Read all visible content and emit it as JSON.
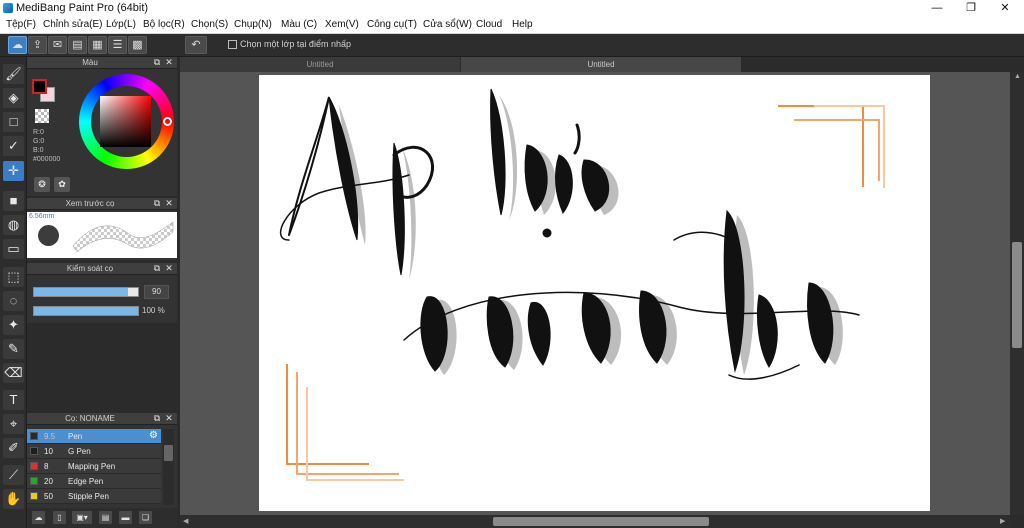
{
  "window": {
    "title": "MediBang Paint Pro (64bit)",
    "minimize": "—",
    "maximize": "❐",
    "close": "✕"
  },
  "menu": [
    "Tệp(F)",
    "Chỉnh sửa(E)",
    "Lớp(L)",
    "Bộ lọc(R)",
    "Chọn(S)",
    "Chụp(N)",
    "Màu (C)",
    "Xem(V)",
    "Công cụ(T)",
    "Cửa sổ(W)",
    "Cloud",
    "Help"
  ],
  "toolbar": {
    "checkbox_label": "Chọn một lớp tại điểm nhấp",
    "checkbox_checked": false
  },
  "color_panel": {
    "title": "Màu",
    "r": "R:0",
    "g": "G:0",
    "b": "B:0",
    "hex": "#000000",
    "foreground": "#000000",
    "background": "#f1d6dc"
  },
  "preview_panel": {
    "title": "Xem trước cọ",
    "size": "6.56mm"
  },
  "control_panel": {
    "title": "Kiểm soát cọ",
    "size_value": "90",
    "size_level": 0.9,
    "opacity_value": "100 %",
    "opacity_level": 1.0
  },
  "brush_panel": {
    "title": "Cọ: NONAME",
    "items": [
      {
        "size": "9.5",
        "name": "Pen",
        "color": "#2a2a2a",
        "selected": true
      },
      {
        "size": "10",
        "name": "G Pen",
        "color": "#1e1e1e",
        "selected": false
      },
      {
        "size": "8",
        "name": "Mapping Pen",
        "color": "#e03030",
        "selected": false
      },
      {
        "size": "20",
        "name": "Edge Pen",
        "color": "#22aa22",
        "selected": false
      },
      {
        "size": "50",
        "name": "Stipple Pen",
        "color": "#e0d020",
        "selected": false
      }
    ]
  },
  "tabs": [
    "Untitled",
    "Untitled"
  ],
  "canvas": {
    "ink_color": "#111111",
    "shadow_color": "#b8b8b8",
    "accent_color": "#f08a3c"
  }
}
